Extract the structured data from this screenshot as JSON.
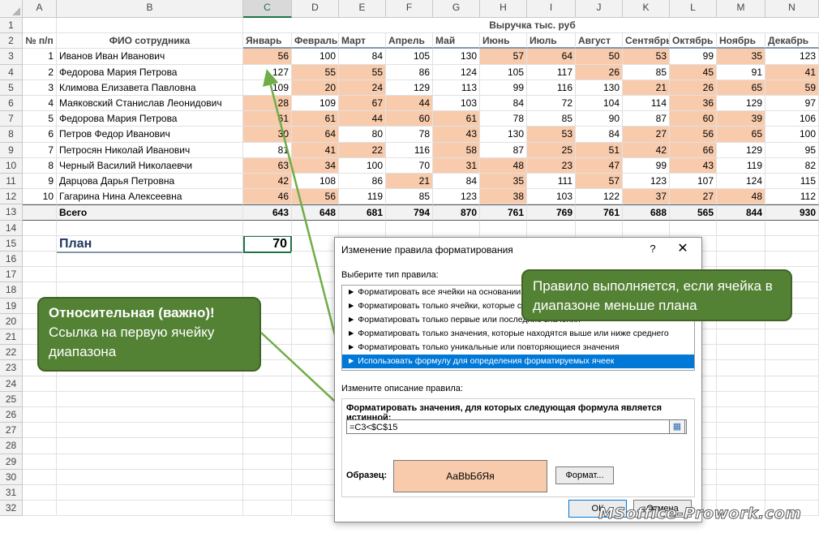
{
  "columns": [
    "A",
    "B",
    "C",
    "D",
    "E",
    "F",
    "G",
    "H",
    "I",
    "J",
    "K",
    "L",
    "M",
    "N"
  ],
  "row_numbers": [
    "1",
    "2",
    "3",
    "4",
    "5",
    "6",
    "7",
    "8",
    "9",
    "10",
    "11",
    "12",
    "13",
    "14",
    "15",
    "16",
    "17",
    "18",
    "19",
    "20",
    "21",
    "22",
    "23",
    "24",
    "25",
    "26",
    "27",
    "28",
    "29",
    "30",
    "31",
    "32"
  ],
  "header": {
    "revenue_title": "Выручка тыс. руб",
    "num_label": "№ п/п",
    "name_label": "ФИО сотрудника",
    "months": [
      "Январь",
      "Февраль",
      "Март",
      "Апрель",
      "Май",
      "Июнь",
      "Июль",
      "Август",
      "Сентябрь",
      "Октябрь",
      "Ноябрь",
      "Декабрь"
    ]
  },
  "employees": [
    {
      "n": "1",
      "name": "Иванов Иван Иванович",
      "v": [
        "56",
        "100",
        "84",
        "105",
        "130",
        "57",
        "64",
        "50",
        "53",
        "99",
        "35",
        "123"
      ]
    },
    {
      "n": "2",
      "name": "Федорова Мария Петрова",
      "v": [
        "127",
        "55",
        "55",
        "86",
        "124",
        "105",
        "117",
        "26",
        "85",
        "45",
        "91",
        "41"
      ]
    },
    {
      "n": "3",
      "name": "Климова Елизавета Павловна",
      "v": [
        "109",
        "20",
        "24",
        "129",
        "113",
        "99",
        "116",
        "130",
        "21",
        "26",
        "65",
        "59"
      ]
    },
    {
      "n": "4",
      "name": "Маяковский Станислав Леонидович",
      "v": [
        "28",
        "109",
        "67",
        "44",
        "103",
        "84",
        "72",
        "104",
        "114",
        "36",
        "129",
        "97"
      ]
    },
    {
      "n": "5",
      "name": "Федорова Мария Петрова",
      "v": [
        "61",
        "61",
        "44",
        "60",
        "61",
        "78",
        "85",
        "90",
        "87",
        "60",
        "39",
        "106"
      ]
    },
    {
      "n": "6",
      "name": "Петров Федор Иванович",
      "v": [
        "30",
        "64",
        "80",
        "78",
        "43",
        "130",
        "53",
        "84",
        "27",
        "56",
        "65",
        "100"
      ]
    },
    {
      "n": "7",
      "name": "Петросян Николай Иванович",
      "v": [
        "81",
        "41",
        "22",
        "116",
        "58",
        "87",
        "25",
        "51",
        "42",
        "66",
        "129",
        "95"
      ]
    },
    {
      "n": "8",
      "name": "Черный Василий Николаевчи",
      "v": [
        "63",
        "34",
        "100",
        "70",
        "31",
        "48",
        "23",
        "47",
        "99",
        "43",
        "119",
        "82"
      ]
    },
    {
      "n": "9",
      "name": "Дарцова Дарья Петровна",
      "v": [
        "42",
        "108",
        "86",
        "21",
        "84",
        "35",
        "111",
        "57",
        "123",
        "107",
        "124",
        "115"
      ]
    },
    {
      "n": "10",
      "name": "Гагарина Нина Алексеевна",
      "v": [
        "46",
        "56",
        "119",
        "85",
        "123",
        "38",
        "103",
        "122",
        "37",
        "27",
        "48",
        "112"
      ]
    }
  ],
  "totals": {
    "label": "Всего",
    "values": [
      "643",
      "648",
      "681",
      "794",
      "870",
      "761",
      "769",
      "761",
      "688",
      "565",
      "844",
      "930"
    ]
  },
  "plan": {
    "label": "План",
    "value": "70"
  },
  "dialog": {
    "title": "Изменение правила форматирования",
    "help": "?",
    "close": "✕",
    "select_type_label": "Выберите тип правила:",
    "rules": [
      "► Форматировать все ячейки на основании их значений",
      "► Форматировать только ячейки, которые содержат",
      "► Форматировать только первые или последние значения",
      "► Форматировать только значения, которые находятся выше или ниже среднего",
      "► Форматировать только уникальные или повторяющиеся значения",
      "► Использовать формулу для определения форматируемых ячеек"
    ],
    "edit_desc_label": "Измените описание правила:",
    "formula_label": "Форматировать значения, для которых следующая формула является истинной:",
    "formula": "=C3<$C$15",
    "sample_label": "Образец:",
    "sample_text": "АаВbБбЯя",
    "format_button": "Формат...",
    "ok_button": "ОК",
    "cancel_button": "Отмена"
  },
  "callouts": {
    "left_bold": "Относительная (важно)!",
    "left_text": "Ссылка на первую ячейку диапазона",
    "right_text": "Правило выполняется, если ячейка в диапазоне меньше плана"
  },
  "watermark": "MSoffice-Prowork.com",
  "colors": {
    "highlight": "#f8cbad",
    "callout": "#548235",
    "selection": "#0078d7"
  }
}
